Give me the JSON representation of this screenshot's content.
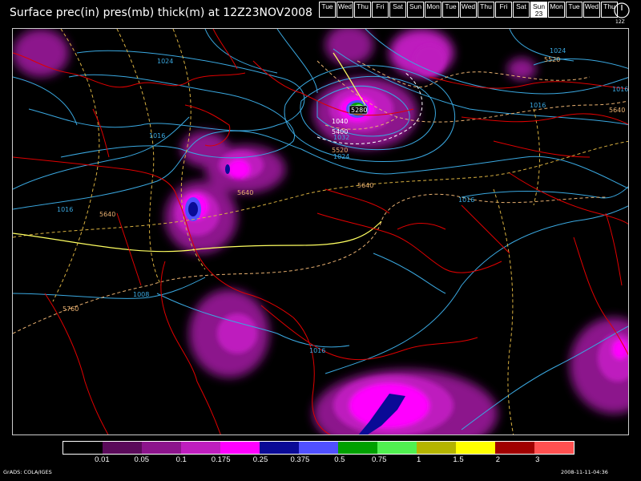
{
  "title": "Surface prec(in) pres(mb) thick(m) at 12Z23NOV2008",
  "day_strip": {
    "days": [
      "Tue",
      "Wed",
      "Thu",
      "Fri",
      "Sat",
      "Sun",
      "Mon",
      "Tue",
      "Wed",
      "Thu",
      "Fri",
      "Sat",
      "Sun",
      "Mon",
      "Tue",
      "Wed",
      "Thu"
    ],
    "active_index": 12,
    "active_date": "23"
  },
  "clock_label": "12Z",
  "map_labels": {
    "isobar_1024_nw": "1024",
    "isobar_1024_ne": "1024",
    "isobar_1016_right": "1016",
    "isobar_1016_ne": "1016",
    "isobar_1016_west": "1016",
    "isobar_1016_left": "1016",
    "isobar_1016_mid": "1016",
    "isobar_1016_south": "1016",
    "isobar_1008": "1008",
    "isobar_1040": "1040",
    "isobar_1032": "1032",
    "isobar_1024_low": "1024",
    "thick_5280": "5280",
    "thick_5400": "5400",
    "thick_5520_n": "5520",
    "thick_5520_ne": "5520",
    "thick_5640_ne": "5640",
    "thick_5640_mid": "5640",
    "thick_5640_w": "5640",
    "thick_5640_c": "5640",
    "thick_5760": "5760"
  },
  "legend": {
    "colors": [
      "#000000",
      "#5a0a5a",
      "#8c148c",
      "#be1ebe",
      "#ff00ff",
      "#0a0a96",
      "#5050ff",
      "#00a000",
      "#50f050",
      "#b4b400",
      "#ffff00",
      "#a00000",
      "#ff5050"
    ],
    "labels": [
      "0.01",
      "0.05",
      "0.1",
      "0.175",
      "0.25",
      "0.375",
      "0.5",
      "0.75",
      "1",
      "1.5",
      "2",
      "3"
    ]
  },
  "footer": {
    "left": "GrADS: COLA/IGES",
    "right": "2008-11-11-04:36"
  }
}
